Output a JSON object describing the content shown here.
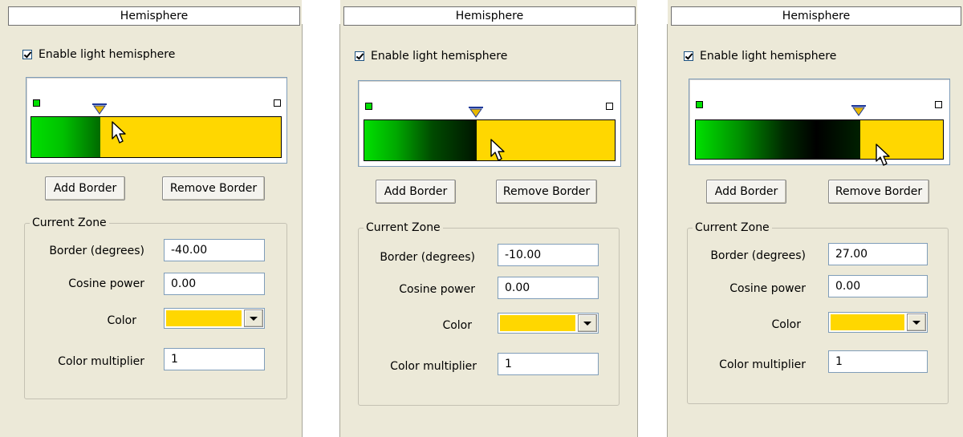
{
  "panels": [
    {
      "header": "Hemisphere",
      "checkbox_label": "Enable light hemisphere",
      "add_border_label": "Add Border",
      "remove_border_label": "Remove Border",
      "group_label": "Current Zone",
      "border_label": "Border (degrees)",
      "border_value": "-40.00",
      "cosine_label": "Cosine power",
      "cosine_value": "0.00",
      "color_label": "Color",
      "color_value": "#ffd700",
      "multiplier_label": "Color multiplier",
      "multiplier_value": "1"
    },
    {
      "header": "Hemisphere",
      "checkbox_label": "Enable light hemisphere",
      "add_border_label": "Add Border",
      "remove_border_label": "Remove Border",
      "group_label": "Current Zone",
      "border_label": "Border (degrees)",
      "border_value": "-10.00",
      "cosine_label": "Cosine power",
      "cosine_value": "0.00",
      "color_label": "Color",
      "color_value": "#ffd700",
      "multiplier_label": "Color multiplier",
      "multiplier_value": "1"
    },
    {
      "header": "Hemisphere",
      "checkbox_label": "Enable light hemisphere",
      "add_border_label": "Add Border",
      "remove_border_label": "Remove Border",
      "group_label": "Current Zone",
      "border_label": "Border (degrees)",
      "border_value": "27.00",
      "cosine_label": "Cosine power",
      "cosine_value": "0.00",
      "color_label": "Color",
      "color_value": "#ffd700",
      "multiplier_label": "Color multiplier",
      "multiplier_value": "1"
    }
  ],
  "colors": {
    "left_end": "#00e000",
    "zone_color": "#ffd700",
    "marker_fill": "#e8b800",
    "marker_line": "#1f3a9a"
  },
  "checkbox_checked": true
}
